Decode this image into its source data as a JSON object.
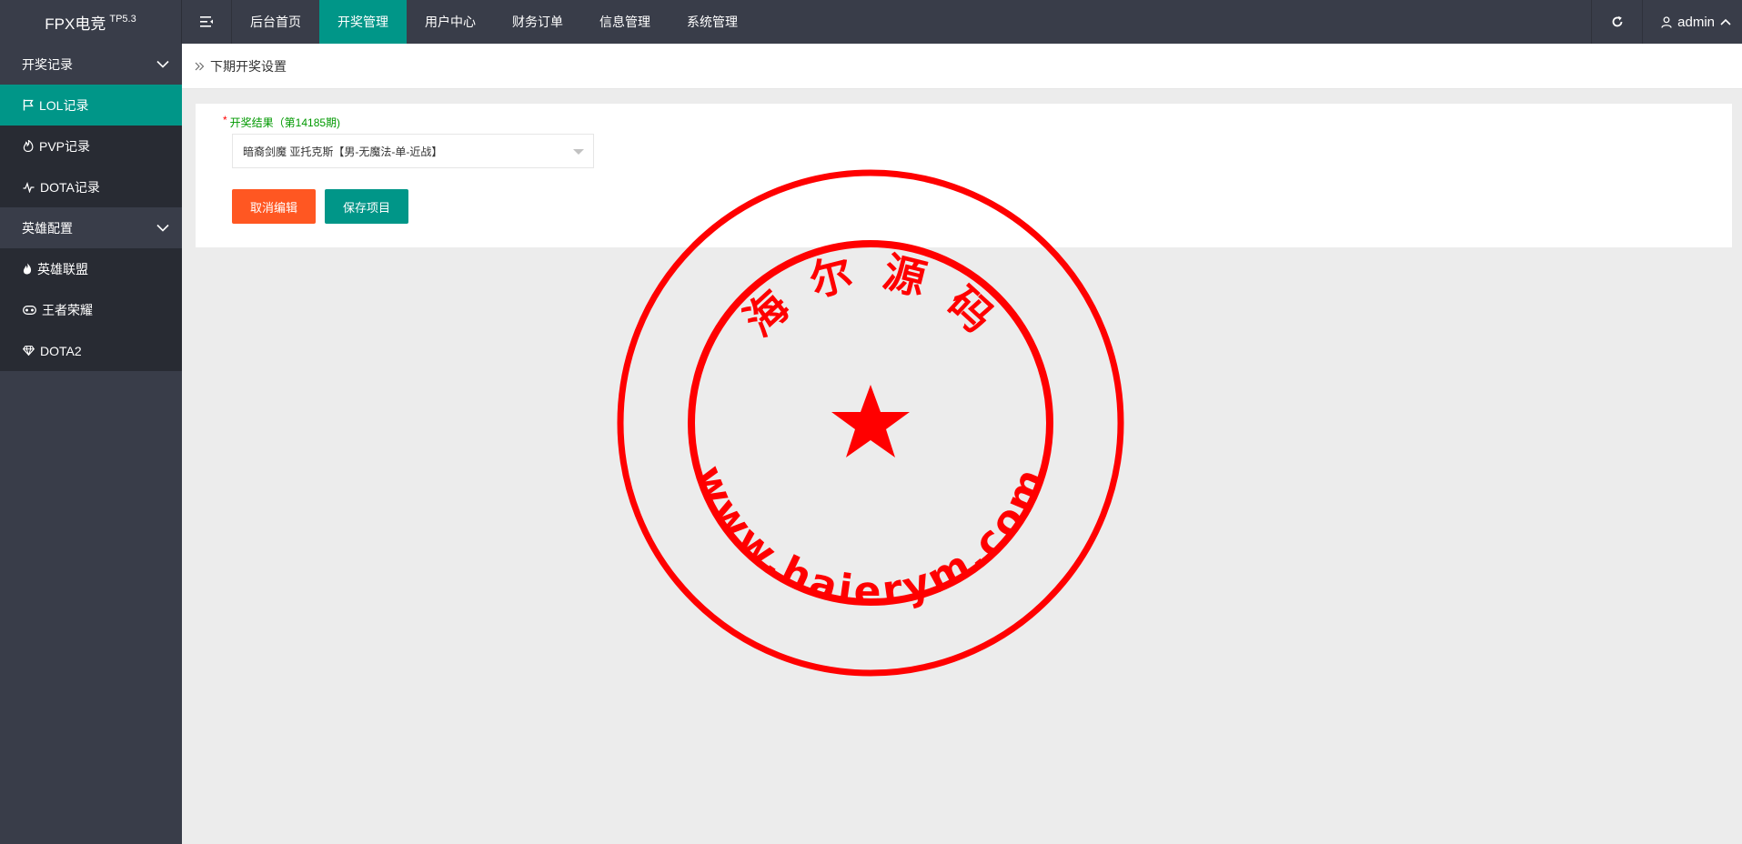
{
  "header": {
    "logo_text": "FPX电竞",
    "logo_version": "TP5.3",
    "menu_toggle_icon": "menu-fold-icon",
    "nav": [
      {
        "label": "后台首页",
        "active": false
      },
      {
        "label": "开奖管理",
        "active": true
      },
      {
        "label": "用户中心",
        "active": false
      },
      {
        "label": "财务订单",
        "active": false
      },
      {
        "label": "信息管理",
        "active": false
      },
      {
        "label": "系统管理",
        "active": false
      }
    ],
    "refresh_icon": "refresh-icon",
    "user_name": "admin"
  },
  "sidebar": {
    "groups": [
      {
        "label": "开奖记录",
        "items": [
          {
            "label": "LOL记录",
            "icon": "flag-icon",
            "active": true
          },
          {
            "label": "PVP记录",
            "icon": "fire-icon",
            "active": false
          },
          {
            "label": "DOTA记录",
            "icon": "pulse-icon",
            "active": false
          }
        ]
      },
      {
        "label": "英雄配置",
        "items": [
          {
            "label": "英雄联盟",
            "icon": "flame-icon",
            "active": false
          },
          {
            "label": "王者荣耀",
            "icon": "gamepad-icon",
            "active": false
          },
          {
            "label": "DOTA2",
            "icon": "diamond-icon",
            "active": false
          }
        ]
      }
    ]
  },
  "breadcrumb": {
    "text": "下期开奖设置"
  },
  "form": {
    "required_mark": "*",
    "label": "开奖结果（第14185期)",
    "select_value": "暗裔剑魔 亚托克斯【男-无魔法-单-近战】",
    "cancel_label": "取消编辑",
    "save_label": "保存项目"
  },
  "watermark": {
    "top_text": "海 尔 源 码",
    "bottom_text": "www.haierym.com",
    "color": "#ff0000"
  },
  "colors": {
    "accent": "#009688",
    "cancel": "#ff5722",
    "topbar": "#393d49"
  }
}
